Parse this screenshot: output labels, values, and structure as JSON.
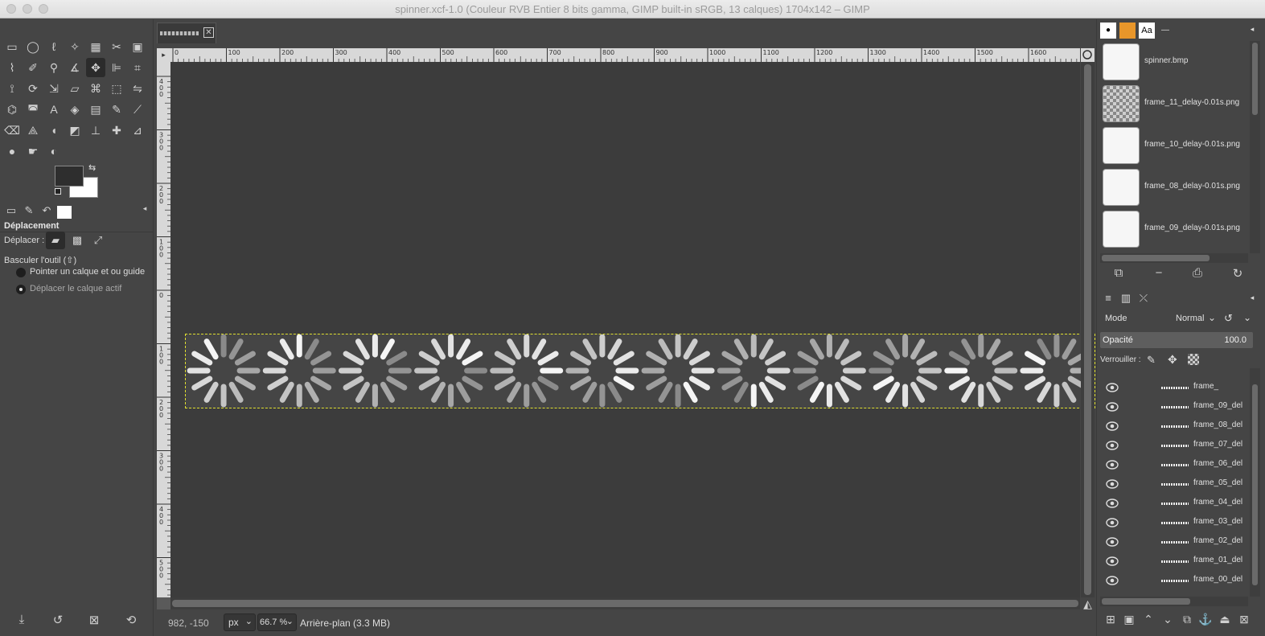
{
  "titlebar": {
    "title": "spinner.xcf-1.0 (Couleur RVB Entier 8 bits gamma, GIMP built-in sRGB, 13 calques) 1704x142 – GIMP"
  },
  "toolbox": {
    "tools": [
      "rect-select-icon",
      "ellipse-select-icon",
      "free-select-icon",
      "fuzzy-select-icon",
      "color-select-icon",
      "scissors-icon",
      "foreground-select-icon",
      "paths-icon",
      "color-picker-icon",
      "zoom-icon",
      "measure-icon",
      "move-icon",
      "align-icon",
      "crop-icon",
      "unified-transform-icon",
      "rotate-icon",
      "scale-icon",
      "shear-icon",
      "warp-icon",
      "perspective-icon",
      "flip-icon",
      "cage-icon",
      "paint-select-icon",
      "text-icon",
      "bucket-fill-icon",
      "gradient-icon",
      "pencil-icon",
      "paintbrush-icon",
      "eraser-icon",
      "airbrush-icon",
      "ink-icon",
      "mypaint-icon",
      "clone-icon",
      "heal-icon",
      "perspective-clone-icon",
      "blur-icon",
      "smudge-icon",
      "dodge-burn-icon"
    ],
    "colors": {
      "foreground": "#2e2e2e",
      "background": "#ffffff"
    }
  },
  "tool_options": {
    "title": "Déplacement",
    "move_label": "Déplacer :",
    "toggle_label": "Basculer l'outil  (⇧)",
    "radio_pick": "Pointer un calque et ou guide",
    "radio_active": "Déplacer le calque actif"
  },
  "ruler": {
    "h_ticks": [
      "0",
      "100",
      "200",
      "300",
      "400",
      "500",
      "600",
      "700",
      "800",
      "900",
      "1000",
      "1100",
      "1200",
      "1300",
      "1400",
      "1500",
      "1600"
    ],
    "v_ticks": [
      [
        "4",
        "0",
        "0"
      ],
      [
        "3",
        "0",
        "0"
      ],
      [
        "2",
        "0",
        "0"
      ],
      [
        "1",
        "0",
        "0"
      ],
      [
        "0"
      ],
      [
        "1",
        "0",
        "0"
      ],
      [
        "2",
        "0",
        "0"
      ],
      [
        "3",
        "0",
        "0"
      ],
      [
        "4",
        "0",
        "0"
      ],
      [
        "5",
        "0",
        "0"
      ]
    ]
  },
  "status": {
    "coords": "982, -150",
    "unit": "px",
    "zoom": "66.7 %",
    "layer_info": "Arrière-plan (3.3 MB)"
  },
  "images": [
    {
      "name": "spinner.bmp",
      "thumb": "plain"
    },
    {
      "name": "frame_11_delay-0.01s.png",
      "thumb": "pattern"
    },
    {
      "name": "frame_10_delay-0.01s.png",
      "thumb": "plain"
    },
    {
      "name": "frame_08_delay-0.01s.png",
      "thumb": "plain"
    },
    {
      "name": "frame_09_delay-0.01s.png",
      "thumb": "plain"
    }
  ],
  "layers_panel": {
    "mode_label": "Mode",
    "mode_value": "Normal",
    "opacity_label": "Opacité",
    "opacity_value": "100.0",
    "lock_label": "Verrouiller :",
    "layers": [
      "frame_",
      "frame_09_del",
      "frame_08_del",
      "frame_07_del",
      "frame_06_del",
      "frame_05_del",
      "frame_04_del",
      "frame_03_del",
      "frame_02_del",
      "frame_01_del",
      "frame_00_del"
    ]
  },
  "spinner": {
    "frames": 12,
    "dim_color": "#8a8a8a",
    "bright_color": "#f5f5f5"
  }
}
